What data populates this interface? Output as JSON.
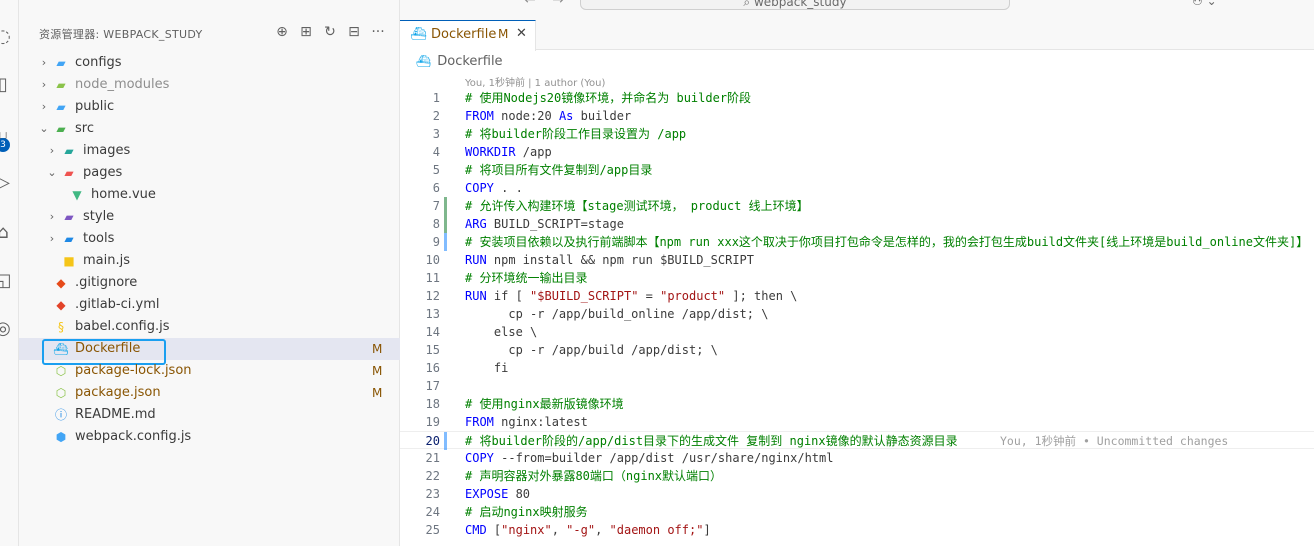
{
  "titlebar": {
    "back": "←",
    "forward": "→",
    "search": "⌕ webpack_study",
    "copilot": "⚇ ⌄"
  },
  "activity": {
    "badge": "3"
  },
  "explorer": {
    "title": "资源管理器: WEBPACK_STUDY",
    "actions": [
      "new-file",
      "new-folder",
      "refresh",
      "collapse",
      "more"
    ],
    "action_glyphs": [
      "⊕",
      "⊞",
      "↻",
      "⊟",
      "···"
    ],
    "items": [
      {
        "name": "configs",
        "type": "folder",
        "depth": 0,
        "open": false,
        "chev": "›",
        "icon": "▰",
        "icon_color": "#42a5f5"
      },
      {
        "name": "node_modules",
        "type": "folder",
        "depth": 0,
        "open": false,
        "chev": "›",
        "icon": "▰",
        "icon_color": "#8bc34a",
        "dim": true
      },
      {
        "name": "public",
        "type": "folder",
        "depth": 0,
        "open": false,
        "chev": "›",
        "icon": "▰",
        "icon_color": "#42a5f5"
      },
      {
        "name": "src",
        "type": "folder",
        "depth": 0,
        "open": true,
        "chev": "⌄",
        "icon": "▰",
        "icon_color": "#4caf50"
      },
      {
        "name": "images",
        "type": "folder",
        "depth": 1,
        "open": false,
        "chev": "›",
        "icon": "▰",
        "icon_color": "#26a69a"
      },
      {
        "name": "pages",
        "type": "folder",
        "depth": 1,
        "open": true,
        "chev": "⌄",
        "icon": "▰",
        "icon_color": "#ef5350"
      },
      {
        "name": "home.vue",
        "type": "file",
        "depth": 2,
        "chev": "",
        "icon": "▼",
        "icon_color": "#41b883"
      },
      {
        "name": "style",
        "type": "folder",
        "depth": 1,
        "open": false,
        "chev": "›",
        "icon": "▰",
        "icon_color": "#7e57c2"
      },
      {
        "name": "tools",
        "type": "folder",
        "depth": 1,
        "open": false,
        "chev": "›",
        "icon": "▰",
        "icon_color": "#1e88e5"
      },
      {
        "name": "main.js",
        "type": "file",
        "depth": 1,
        "chev": "",
        "icon": "■",
        "icon_color": "#f5c518"
      },
      {
        "name": ".gitignore",
        "type": "file",
        "depth": 0,
        "chev": "",
        "icon": "◆",
        "icon_color": "#e64a19"
      },
      {
        "name": ".gitlab-ci.yml",
        "type": "file",
        "depth": 0,
        "chev": "",
        "icon": "◆",
        "icon_color": "#e24329"
      },
      {
        "name": "babel.config.js",
        "type": "file",
        "depth": 0,
        "chev": "",
        "icon": "§",
        "icon_color": "#f5c518"
      },
      {
        "name": "Dockerfile",
        "type": "file",
        "depth": 0,
        "chev": "",
        "icon": "⛴",
        "icon_color": "#0ea5e9",
        "selected": true,
        "modified": "M"
      },
      {
        "name": "package-lock.json",
        "type": "file",
        "depth": 0,
        "chev": "",
        "icon": "⬡",
        "icon_color": "#8bc34a",
        "modified": "M"
      },
      {
        "name": "package.json",
        "type": "file",
        "depth": 0,
        "chev": "",
        "icon": "⬡",
        "icon_color": "#8bc34a",
        "modified": "M"
      },
      {
        "name": "README.md",
        "type": "file",
        "depth": 0,
        "chev": "",
        "icon": "ⓘ",
        "icon_color": "#1e88e5"
      },
      {
        "name": "webpack.config.js",
        "type": "file",
        "depth": 0,
        "chev": "",
        "icon": "⬢",
        "icon_color": "#42a5f5"
      }
    ]
  },
  "tab": {
    "label": "Dockerfile",
    "badge": "M",
    "close": "✕"
  },
  "breadcrumb": {
    "label": "Dockerfile"
  },
  "codelens": "You, 1秒钟前 | 1 author (You)",
  "blame": "You, 1秒钟前 • Uncommitted changes",
  "lines": [
    {
      "n": "1",
      "gutter": "",
      "segs": [
        [
          "c",
          "# 使用Nodejs20镜像环境，并命名为 builder阶段"
        ]
      ]
    },
    {
      "n": "2",
      "gutter": "",
      "segs": [
        [
          "k",
          "FROM"
        ],
        [
          "p",
          " node:20 "
        ],
        [
          "k",
          "As"
        ],
        [
          "p",
          " builder"
        ]
      ]
    },
    {
      "n": "3",
      "gutter": "",
      "segs": [
        [
          "c",
          "# 将builder阶段工作目录设置为 /app"
        ]
      ]
    },
    {
      "n": "4",
      "gutter": "",
      "segs": [
        [
          "k",
          "WORKDIR"
        ],
        [
          "p",
          " /app"
        ]
      ]
    },
    {
      "n": "5",
      "gutter": "",
      "segs": [
        [
          "c",
          "# 将项目所有文件复制到/app目录"
        ]
      ]
    },
    {
      "n": "6",
      "gutter": "",
      "segs": [
        [
          "k",
          "COPY"
        ],
        [
          "p",
          " . ."
        ]
      ]
    },
    {
      "n": "7",
      "gutter": "add",
      "segs": [
        [
          "c",
          "# 允许传入构建环境【stage测试环境， product 线上环境】"
        ]
      ]
    },
    {
      "n": "8",
      "gutter": "add",
      "segs": [
        [
          "k",
          "ARG"
        ],
        [
          "p",
          " BUILD_SCRIPT=stage"
        ]
      ]
    },
    {
      "n": "9",
      "gutter": "mod",
      "segs": [
        [
          "c",
          "# 安装项目依赖以及执行前端脚本【npm run xxx这个取决于你项目打包命令是怎样的，我的会打包生成build文件夹[线上环境是build_online文件夹]】"
        ]
      ]
    },
    {
      "n": "10",
      "gutter": "",
      "segs": [
        [
          "k",
          "RUN"
        ],
        [
          "p",
          " npm install && npm run $BUILD_SCRIPT"
        ]
      ]
    },
    {
      "n": "11",
      "gutter": "",
      "segs": [
        [
          "c",
          "# 分环境统一输出目录"
        ]
      ]
    },
    {
      "n": "12",
      "gutter": "",
      "segs": [
        [
          "k",
          "RUN"
        ],
        [
          "p",
          " if [ "
        ],
        [
          "s",
          "\"$BUILD_SCRIPT\""
        ],
        [
          "p",
          " = "
        ],
        [
          "s",
          "\"product\""
        ],
        [
          "p",
          " ]; then \\"
        ]
      ]
    },
    {
      "n": "13",
      "gutter": "",
      "segs": [
        [
          "p",
          "      cp -r /app/build_online /app/dist; \\"
        ]
      ]
    },
    {
      "n": "14",
      "gutter": "",
      "segs": [
        [
          "p",
          "    else \\"
        ]
      ]
    },
    {
      "n": "15",
      "gutter": "",
      "segs": [
        [
          "p",
          "      cp -r /app/build /app/dist; \\"
        ]
      ]
    },
    {
      "n": "16",
      "gutter": "",
      "segs": [
        [
          "p",
          "    fi"
        ]
      ]
    },
    {
      "n": "17",
      "gutter": "",
      "segs": []
    },
    {
      "n": "18",
      "gutter": "",
      "segs": [
        [
          "c",
          "# 使用nginx最新版镜像环境"
        ]
      ]
    },
    {
      "n": "19",
      "gutter": "",
      "segs": [
        [
          "k",
          "FROM"
        ],
        [
          "p",
          " nginx:latest"
        ]
      ]
    },
    {
      "n": "20",
      "gutter": "mod",
      "current": true,
      "segs": [
        [
          "c",
          "# 将builder阶段的/app/dist目录下的生成文件 复制到 nginx镜像的默认静态资源目录"
        ]
      ]
    },
    {
      "n": "21",
      "gutter": "",
      "segs": [
        [
          "k",
          "COPY"
        ],
        [
          "p",
          " --from=builder /app/dist /usr/share/nginx/html"
        ]
      ]
    },
    {
      "n": "22",
      "gutter": "",
      "segs": [
        [
          "c",
          "# 声明容器对外暴露80端口（nginx默认端口）"
        ]
      ]
    },
    {
      "n": "23",
      "gutter": "",
      "segs": [
        [
          "k",
          "EXPOSE"
        ],
        [
          "p",
          " 80"
        ]
      ]
    },
    {
      "n": "24",
      "gutter": "",
      "segs": [
        [
          "c",
          "# 启动nginx映射服务"
        ]
      ]
    },
    {
      "n": "25",
      "gutter": "",
      "segs": [
        [
          "k",
          "CMD"
        ],
        [
          "p",
          " ["
        ],
        [
          "s",
          "\"nginx\""
        ],
        [
          "p",
          ", "
        ],
        [
          "s",
          "\"-g\""
        ],
        [
          "p",
          ", "
        ],
        [
          "s",
          "\"daemon off;\""
        ],
        [
          "p",
          "]"
        ]
      ]
    }
  ]
}
